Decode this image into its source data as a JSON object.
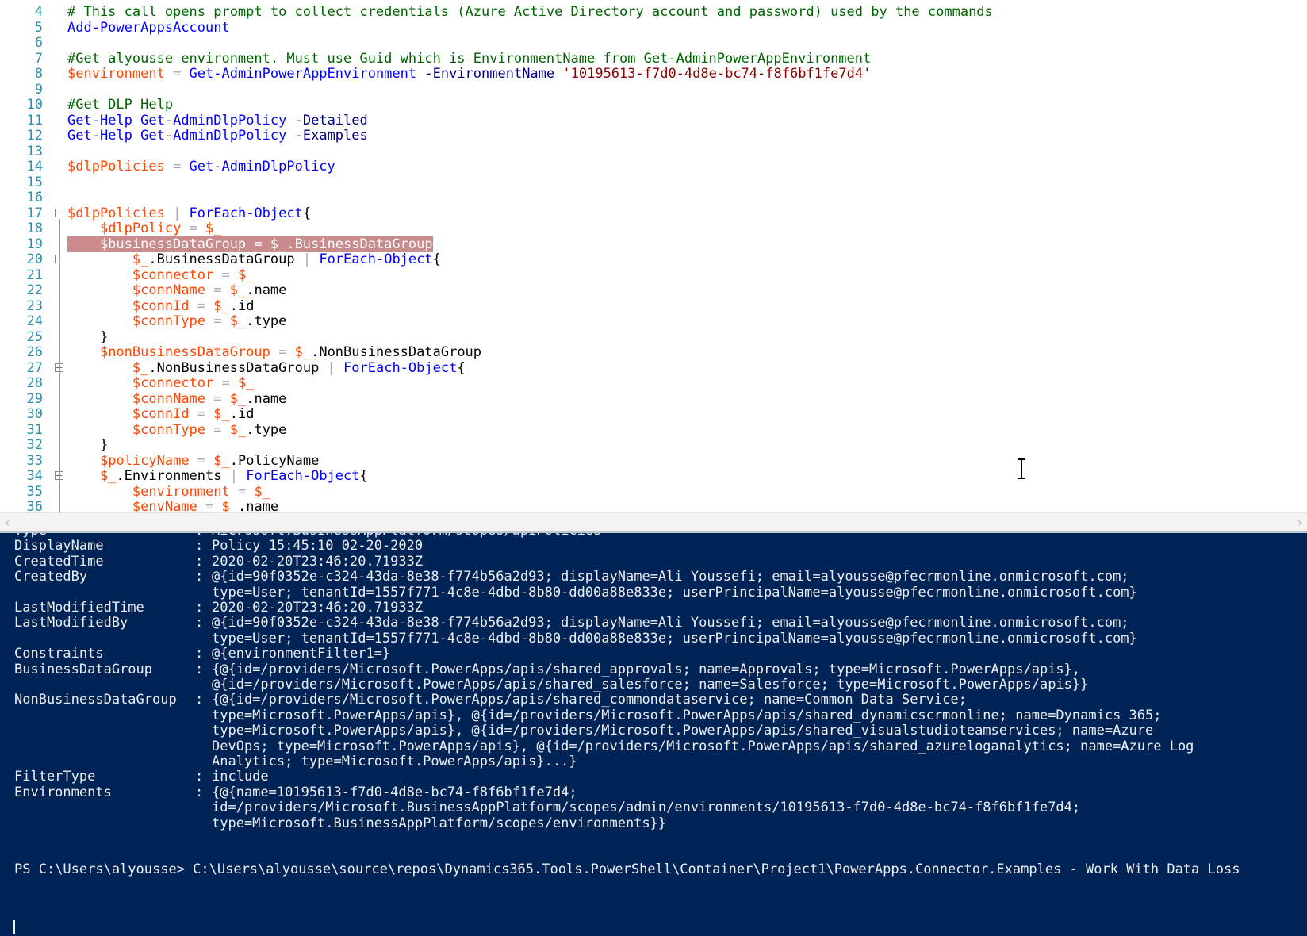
{
  "editor": {
    "lines": [
      {
        "n": "4",
        "tokens": [
          {
            "t": "comment",
            "v": "# This call opens prompt to collect credentials (Azure Active Directory account and password) used by the commands"
          }
        ]
      },
      {
        "n": "5",
        "tokens": [
          {
            "t": "cmd",
            "v": "Add-PowerAppsAccount"
          }
        ]
      },
      {
        "n": "6",
        "tokens": []
      },
      {
        "n": "7",
        "tokens": [
          {
            "t": "comment",
            "v": "#Get alyousse environment. Must use Guid which is EnvironmentName from Get-AdminPowerAppEnvironment"
          }
        ]
      },
      {
        "n": "8",
        "tokens": [
          {
            "t": "var",
            "v": "$environment"
          },
          {
            "t": "op",
            "v": " = "
          },
          {
            "t": "cmd",
            "v": "Get-AdminPowerAppEnvironment"
          },
          {
            "t": "txt",
            "v": " "
          },
          {
            "t": "param",
            "v": "-EnvironmentName"
          },
          {
            "t": "txt",
            "v": " "
          },
          {
            "t": "str",
            "v": "'10195613-f7d0-4d8e-bc74-f8f6bf1fe7d4'"
          }
        ]
      },
      {
        "n": "9",
        "tokens": []
      },
      {
        "n": "10",
        "tokens": [
          {
            "t": "comment",
            "v": "#Get DLP Help"
          }
        ]
      },
      {
        "n": "11",
        "tokens": [
          {
            "t": "cmd",
            "v": "Get-Help"
          },
          {
            "t": "txt",
            "v": " "
          },
          {
            "t": "cmd",
            "v": "Get-AdminDlpPolicy"
          },
          {
            "t": "txt",
            "v": " "
          },
          {
            "t": "param",
            "v": "-Detailed"
          }
        ]
      },
      {
        "n": "12",
        "tokens": [
          {
            "t": "cmd",
            "v": "Get-Help"
          },
          {
            "t": "txt",
            "v": " "
          },
          {
            "t": "cmd",
            "v": "Get-AdminDlpPolicy"
          },
          {
            "t": "txt",
            "v": " "
          },
          {
            "t": "param",
            "v": "-Examples"
          }
        ]
      },
      {
        "n": "13",
        "tokens": []
      },
      {
        "n": "14",
        "tokens": [
          {
            "t": "var",
            "v": "$dlpPolicies"
          },
          {
            "t": "op",
            "v": " = "
          },
          {
            "t": "cmd",
            "v": "Get-AdminDlpPolicy"
          }
        ]
      },
      {
        "n": "15",
        "tokens": []
      },
      {
        "n": "16",
        "tokens": []
      },
      {
        "n": "17",
        "fold": true,
        "tokens": [
          {
            "t": "var",
            "v": "$dlpPolicies"
          },
          {
            "t": "op",
            "v": " | "
          },
          {
            "t": "cmd",
            "v": "ForEach-Object"
          },
          {
            "t": "txt",
            "v": "{"
          }
        ]
      },
      {
        "n": "18",
        "tokens": [
          {
            "t": "txt",
            "v": "    "
          },
          {
            "t": "var",
            "v": "$dlpPolicy"
          },
          {
            "t": "op",
            "v": " = "
          },
          {
            "t": "var",
            "v": "$_"
          }
        ]
      },
      {
        "n": "19",
        "highlight": true,
        "tokens": [
          {
            "t": "hl",
            "v": "    $businessDataGroup = $_.BusinessDataGroup"
          }
        ]
      },
      {
        "n": "20",
        "fold": true,
        "tokens": [
          {
            "t": "txt",
            "v": "        "
          },
          {
            "t": "var",
            "v": "$_"
          },
          {
            "t": "txt",
            "v": ".BusinessDataGroup"
          },
          {
            "t": "op",
            "v": " | "
          },
          {
            "t": "cmd",
            "v": "ForEach-Object"
          },
          {
            "t": "txt",
            "v": "{"
          }
        ]
      },
      {
        "n": "21",
        "tokens": [
          {
            "t": "txt",
            "v": "        "
          },
          {
            "t": "var",
            "v": "$connector"
          },
          {
            "t": "op",
            "v": " = "
          },
          {
            "t": "var",
            "v": "$_"
          }
        ]
      },
      {
        "n": "22",
        "tokens": [
          {
            "t": "txt",
            "v": "        "
          },
          {
            "t": "var",
            "v": "$connName"
          },
          {
            "t": "op",
            "v": " = "
          },
          {
            "t": "var",
            "v": "$_"
          },
          {
            "t": "txt",
            "v": ".name"
          }
        ]
      },
      {
        "n": "23",
        "tokens": [
          {
            "t": "txt",
            "v": "        "
          },
          {
            "t": "var",
            "v": "$connId"
          },
          {
            "t": "op",
            "v": " = "
          },
          {
            "t": "var",
            "v": "$_"
          },
          {
            "t": "txt",
            "v": ".id"
          }
        ]
      },
      {
        "n": "24",
        "tokens": [
          {
            "t": "txt",
            "v": "        "
          },
          {
            "t": "var",
            "v": "$connType"
          },
          {
            "t": "op",
            "v": " = "
          },
          {
            "t": "var",
            "v": "$_"
          },
          {
            "t": "txt",
            "v": ".type"
          }
        ]
      },
      {
        "n": "25",
        "tokens": [
          {
            "t": "txt",
            "v": "    }"
          }
        ]
      },
      {
        "n": "26",
        "tokens": [
          {
            "t": "txt",
            "v": "    "
          },
          {
            "t": "var",
            "v": "$nonBusinessDataGroup"
          },
          {
            "t": "op",
            "v": " = "
          },
          {
            "t": "var",
            "v": "$_"
          },
          {
            "t": "txt",
            "v": ".NonBusinessDataGroup"
          }
        ]
      },
      {
        "n": "27",
        "fold": true,
        "tokens": [
          {
            "t": "txt",
            "v": "        "
          },
          {
            "t": "var",
            "v": "$_"
          },
          {
            "t": "txt",
            "v": ".NonBusinessDataGroup"
          },
          {
            "t": "op",
            "v": " | "
          },
          {
            "t": "cmd",
            "v": "ForEach-Object"
          },
          {
            "t": "txt",
            "v": "{"
          }
        ]
      },
      {
        "n": "28",
        "tokens": [
          {
            "t": "txt",
            "v": "        "
          },
          {
            "t": "var",
            "v": "$connector"
          },
          {
            "t": "op",
            "v": " = "
          },
          {
            "t": "var",
            "v": "$_"
          }
        ]
      },
      {
        "n": "29",
        "tokens": [
          {
            "t": "txt",
            "v": "        "
          },
          {
            "t": "var",
            "v": "$connName"
          },
          {
            "t": "op",
            "v": " = "
          },
          {
            "t": "var",
            "v": "$_"
          },
          {
            "t": "txt",
            "v": ".name"
          }
        ]
      },
      {
        "n": "30",
        "tokens": [
          {
            "t": "txt",
            "v": "        "
          },
          {
            "t": "var",
            "v": "$connId"
          },
          {
            "t": "op",
            "v": " = "
          },
          {
            "t": "var",
            "v": "$_"
          },
          {
            "t": "txt",
            "v": ".id"
          }
        ]
      },
      {
        "n": "31",
        "tokens": [
          {
            "t": "txt",
            "v": "        "
          },
          {
            "t": "var",
            "v": "$connType"
          },
          {
            "t": "op",
            "v": " = "
          },
          {
            "t": "var",
            "v": "$_"
          },
          {
            "t": "txt",
            "v": ".type"
          }
        ]
      },
      {
        "n": "32",
        "tokens": [
          {
            "t": "txt",
            "v": "    }"
          }
        ]
      },
      {
        "n": "33",
        "tokens": [
          {
            "t": "txt",
            "v": "    "
          },
          {
            "t": "var",
            "v": "$policyName"
          },
          {
            "t": "op",
            "v": " = "
          },
          {
            "t": "var",
            "v": "$_"
          },
          {
            "t": "txt",
            "v": ".PolicyName"
          }
        ]
      },
      {
        "n": "34",
        "fold": true,
        "tokens": [
          {
            "t": "txt",
            "v": "    "
          },
          {
            "t": "var",
            "v": "$_"
          },
          {
            "t": "txt",
            "v": ".Environments"
          },
          {
            "t": "op",
            "v": " | "
          },
          {
            "t": "cmd",
            "v": "ForEach-Object"
          },
          {
            "t": "txt",
            "v": "{"
          }
        ]
      },
      {
        "n": "35",
        "tokens": [
          {
            "t": "txt",
            "v": "        "
          },
          {
            "t": "var",
            "v": "$environment"
          },
          {
            "t": "op",
            "v": " = "
          },
          {
            "t": "var",
            "v": "$_"
          }
        ]
      },
      {
        "n": "36",
        "tokens": [
          {
            "t": "txt",
            "v": "        "
          },
          {
            "t": "var",
            "v": "$envName"
          },
          {
            "t": "op",
            "v": " = "
          },
          {
            "t": "var",
            "v": "$_"
          },
          {
            "t": "txt",
            "v": ".name"
          }
        ]
      }
    ],
    "colors": {
      "comment": "#006400",
      "command": "#0000ff",
      "variable": "#ff4500",
      "parameter": "#000080",
      "string": "#8b0000",
      "highlight": "#c98b8b"
    }
  },
  "scrollbar": {
    "left_arrow": "‹",
    "right_arrow": "›"
  },
  "console": {
    "background": "#012456",
    "partial_top": {
      "key": "Type",
      "value": "Microsoft.BusinessAppPlatform/scopes/apiPolicies"
    },
    "rows": [
      {
        "key": "DisplayName",
        "lines": [
          "Policy 15:45:10 02-20-2020"
        ]
      },
      {
        "key": "CreatedTime",
        "lines": [
          "2020-02-20T23:46:20.71933Z"
        ]
      },
      {
        "key": "CreatedBy",
        "lines": [
          "@{id=90f0352e-c324-43da-8e38-f774b56a2d93; displayName=Ali Youssefi; email=alyousse@pfecrmonline.onmicrosoft.com;",
          "type=User; tenantId=1557f771-4c8e-4dbd-8b80-dd00a88e833e; userPrincipalName=alyousse@pfecrmonline.onmicrosoft.com}"
        ]
      },
      {
        "key": "LastModifiedTime",
        "lines": [
          "2020-02-20T23:46:20.71933Z"
        ]
      },
      {
        "key": "LastModifiedBy",
        "lines": [
          "@{id=90f0352e-c324-43da-8e38-f774b56a2d93; displayName=Ali Youssefi; email=alyousse@pfecrmonline.onmicrosoft.com;",
          "type=User; tenantId=1557f771-4c8e-4dbd-8b80-dd00a88e833e; userPrincipalName=alyousse@pfecrmonline.onmicrosoft.com}"
        ]
      },
      {
        "key": "Constraints",
        "lines": [
          "@{environmentFilter1=}"
        ]
      },
      {
        "key": "BusinessDataGroup",
        "lines": [
          "{@{id=/providers/Microsoft.PowerApps/apis/shared_approvals; name=Approvals; type=Microsoft.PowerApps/apis},",
          "@{id=/providers/Microsoft.PowerApps/apis/shared_salesforce; name=Salesforce; type=Microsoft.PowerApps/apis}}"
        ]
      },
      {
        "key": "NonBusinessDataGroup",
        "lines": [
          "{@{id=/providers/Microsoft.PowerApps/apis/shared_commondataservice; name=Common Data Service;",
          "type=Microsoft.PowerApps/apis}, @{id=/providers/Microsoft.PowerApps/apis/shared_dynamicscrmonline; name=Dynamics 365;",
          "type=Microsoft.PowerApps/apis}, @{id=/providers/Microsoft.PowerApps/apis/shared_visualstudioteamservices; name=Azure",
          "DevOps; type=Microsoft.PowerApps/apis}, @{id=/providers/Microsoft.PowerApps/apis/shared_azureloganalytics; name=Azure Log",
          "Analytics; type=Microsoft.PowerApps/apis}...}"
        ]
      },
      {
        "key": "FilterType",
        "lines": [
          "include"
        ]
      },
      {
        "key": "Environments",
        "lines": [
          "{@{name=10195613-f7d0-4d8e-bc74-f8f6bf1fe7d4;",
          "id=/providers/Microsoft.BusinessAppPlatform/scopes/admin/environments/10195613-f7d0-4d8e-bc74-f8f6bf1fe7d4;",
          "type=Microsoft.BusinessAppPlatform/scopes/environments}}"
        ]
      }
    ],
    "separator": ":",
    "prompt": "PS C:\\Users\\alyousse> C:\\Users\\alyousse\\source\\repos\\Dynamics365.Tools.PowerShell\\Container\\Project1\\PowerApps.Connector.Examples - Work With Data Loss"
  }
}
